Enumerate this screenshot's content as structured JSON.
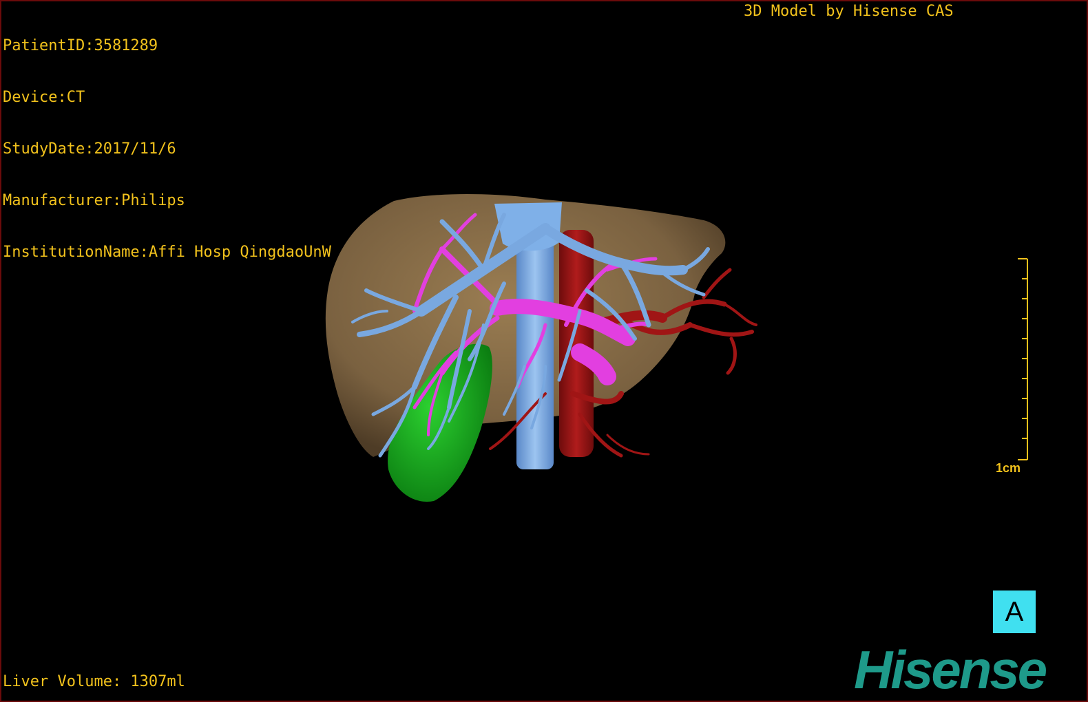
{
  "header": {
    "patient_line": "PatientID:3581289",
    "device_line": "Device:CT",
    "study_date_line": "StudyDate:2017/11/6",
    "manufacturer_line": "Manufacturer:Philips",
    "institution_line": "InstitutionName:Affi Hosp QingdaoUnW",
    "credit": "3D Model by Hisense CAS"
  },
  "footer": {
    "liver_volume": "Liver Volume: 1307ml"
  },
  "scale": {
    "label": "1cm"
  },
  "orientation": {
    "label": "A"
  },
  "brand": {
    "logo_text": "Hisense",
    "logo_color": "#1e9a8a"
  },
  "colors": {
    "overlay_text": "#f2c21c",
    "liver": "#8a7048",
    "portal_vein": "#79a8e0",
    "hepatic_vein": "#e23fe0",
    "artery": "#a01515",
    "gallbladder": "#14b01a",
    "orientation_box": "#40e0f0"
  }
}
